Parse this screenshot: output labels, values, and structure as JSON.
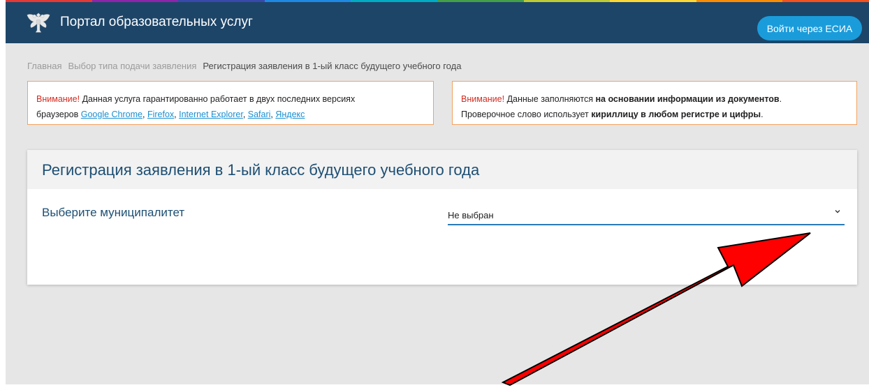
{
  "header": {
    "portal_title": "Портал образовательных услуг",
    "login_button": "Войти через ЕСИА",
    "background": "#1d4568",
    "rainbow_colors": [
      "#e53935",
      "#8e24aa",
      "#3949ab",
      "#1e88e5",
      "#00acc1",
      "#43a047",
      "#c0ca33",
      "#fdd835",
      "#fb8c00",
      "#f4511e"
    ]
  },
  "breadcrumb": {
    "items": [
      {
        "label": "Главная"
      },
      {
        "label": "Выбор типа подачи заявления"
      },
      {
        "label": "Регистрация заявления в 1-ый класс будущего учебного года"
      }
    ]
  },
  "notices": {
    "left": {
      "warning": "Внимание!",
      "text1": " Данная услуга гарантированно работает в двух последних версиях",
      "text2": "браузеров ",
      "browsers": [
        "Google Chrome",
        "Firefox",
        "Internet Explorer",
        "Safari",
        "Яндекс"
      ]
    },
    "right": {
      "warning": "Внимание!",
      "text1": " Данные заполняются ",
      "bold1": "на основании информации из документов",
      "text2": ".",
      "text3": "Проверочное слово использует ",
      "bold2": "кириллицу в любом регистре и цифры",
      "text4": "."
    }
  },
  "form": {
    "title": "Регистрация заявления в 1-ый класс будущего учебного года",
    "municipality_label": "Выберите муниципалитет",
    "municipality_value": "Не выбран"
  },
  "colors": {
    "accent": "#1a9cdb",
    "warning": "#d42b20",
    "notice_border": "#f3a25f",
    "annotation_arrow": "#ff0000"
  },
  "icons": {
    "emblem": "coat-of-arms-icon",
    "select": "chevron-down-icon",
    "annotation": "red-arrow-icon"
  }
}
